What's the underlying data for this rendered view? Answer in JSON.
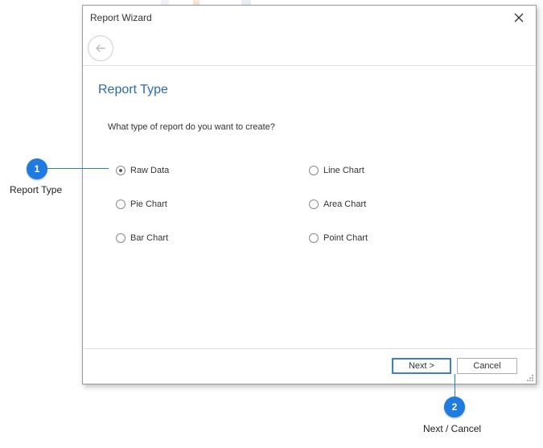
{
  "dialog": {
    "title": "Report Wizard",
    "section_title": "Report Type",
    "question": "What type of report do you want to create?",
    "options": [
      {
        "label": "Raw Data",
        "checked": true
      },
      {
        "label": "Pie Chart",
        "checked": false
      },
      {
        "label": "Bar Chart",
        "checked": false
      },
      {
        "label": "Line Chart",
        "checked": false
      },
      {
        "label": "Area Chart",
        "checked": false
      },
      {
        "label": "Point Chart",
        "checked": false
      }
    ],
    "next_label": "Next >",
    "cancel_label": "Cancel"
  },
  "callouts": [
    {
      "number": "1",
      "label": "Report Type"
    },
    {
      "number": "2",
      "label": "Next / Cancel"
    }
  ],
  "colors": {
    "accent": "#1f7be0",
    "section_title": "#2b6cb0"
  },
  "icons": {
    "close": "close-icon",
    "back": "back-arrow-icon"
  }
}
